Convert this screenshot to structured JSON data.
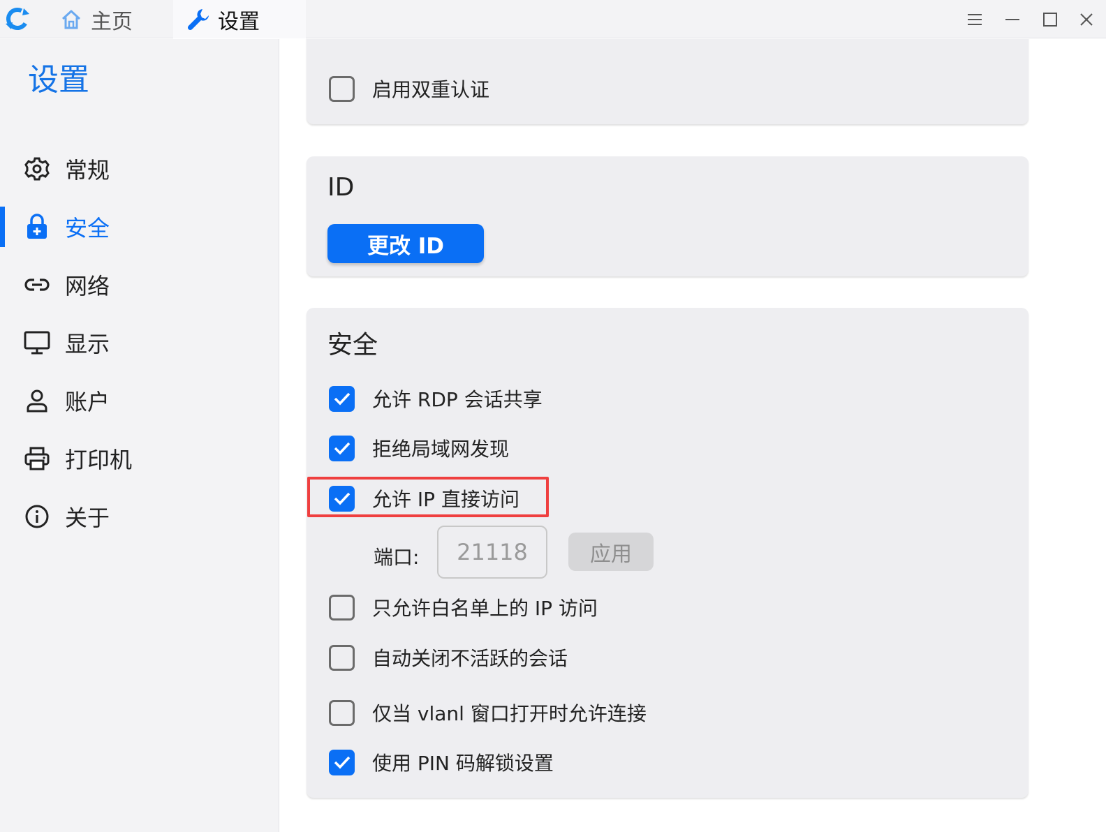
{
  "titlebar": {
    "tabs": [
      {
        "label": "主页",
        "icon": "home-icon"
      },
      {
        "label": "设置",
        "icon": "wrench-icon"
      }
    ],
    "controls": [
      "menu-icon",
      "minimize-icon",
      "maximize-icon",
      "close-icon"
    ]
  },
  "sidebar": {
    "title": "设置",
    "items": [
      {
        "label": "常规",
        "icon": "gear-icon"
      },
      {
        "label": "安全",
        "icon": "lock-icon",
        "active": true
      },
      {
        "label": "网络",
        "icon": "link-icon"
      },
      {
        "label": "显示",
        "icon": "monitor-icon"
      },
      {
        "label": "账户",
        "icon": "user-icon"
      },
      {
        "label": "打印机",
        "icon": "printer-icon"
      },
      {
        "label": "关于",
        "icon": "info-icon"
      }
    ]
  },
  "cards": {
    "twofa": {
      "enable_2fa": {
        "label": "启用双重认证",
        "checked": false
      }
    },
    "id": {
      "title": "ID",
      "change_id_label": "更改 ID"
    },
    "security": {
      "title": "安全",
      "options": [
        {
          "label": "允许 RDP 会话共享",
          "checked": true
        },
        {
          "label": "拒绝局域网发现",
          "checked": true
        },
        {
          "label": "允许 IP 直接访问",
          "checked": true
        },
        {
          "label": "只允许白名单上的 IP 访问",
          "checked": false
        },
        {
          "label": "自动关闭不活跃的会话",
          "checked": false
        },
        {
          "label": "仅当 vlanl 窗口打开时允许连接",
          "checked": false
        },
        {
          "label": "使用 PIN 码解锁设置",
          "checked": true
        }
      ],
      "port": {
        "label": "端口:",
        "placeholder": "21118",
        "apply_label": "应用"
      }
    }
  },
  "colors": {
    "accent": "#0a6ff5",
    "highlight": "#ef3f3f",
    "card": "#eeeef1"
  }
}
